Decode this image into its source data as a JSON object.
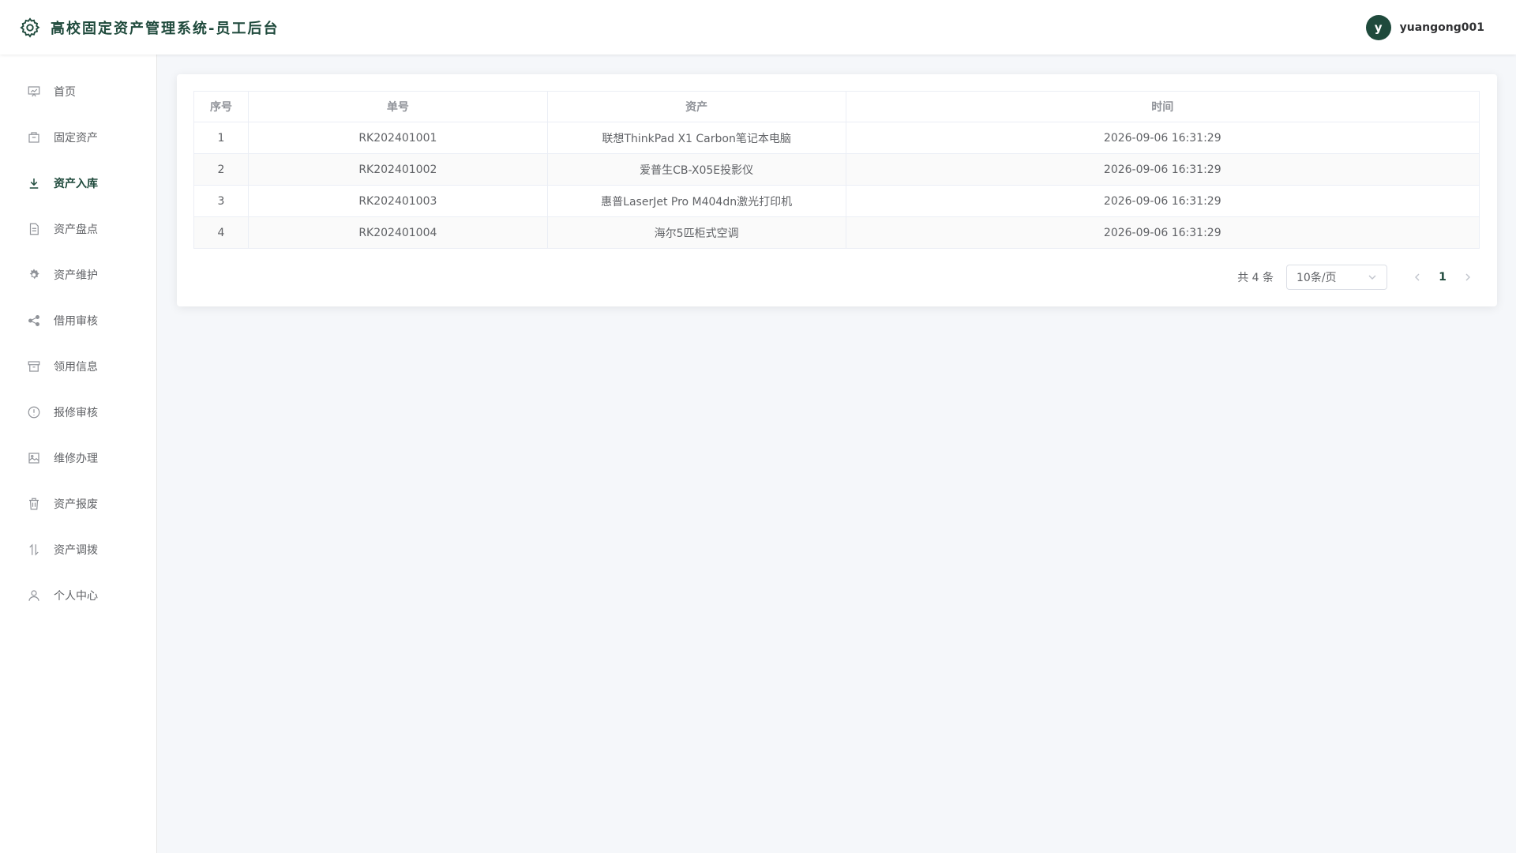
{
  "header": {
    "title": "高校固定资产管理系统-员工后台",
    "avatar_letter": "y",
    "username": "yuangong001",
    "brand_color": "#1f4a3c"
  },
  "sidebar": {
    "items": [
      {
        "label": "首页",
        "icon": "chart-board-icon"
      },
      {
        "label": "固定资产",
        "icon": "box-icon"
      },
      {
        "label": "资产入库",
        "icon": "download-icon",
        "active": true
      },
      {
        "label": "资产盘点",
        "icon": "document-icon"
      },
      {
        "label": "资产维护",
        "icon": "gear-icon"
      },
      {
        "label": "借用审核",
        "icon": "share-icon"
      },
      {
        "label": "领用信息",
        "icon": "archive-icon"
      },
      {
        "label": "报修审核",
        "icon": "info-circle-icon"
      },
      {
        "label": "维修办理",
        "icon": "picture-icon"
      },
      {
        "label": "资产报废",
        "icon": "trash-icon"
      },
      {
        "label": "资产调拨",
        "icon": "transfer-icon"
      },
      {
        "label": "个人中心",
        "icon": "user-icon"
      }
    ]
  },
  "table": {
    "columns": [
      "序号",
      "单号",
      "资产",
      "时间"
    ],
    "rows": [
      [
        "1",
        "RK202401001",
        "联想ThinkPad X1 Carbon笔记本电脑",
        "2026-09-06 16:31:29"
      ],
      [
        "2",
        "RK202401002",
        "爱普生CB-X05E投影仪",
        "2026-09-06 16:31:29"
      ],
      [
        "3",
        "RK202401003",
        "惠普LaserJet Pro M404dn激光打印机",
        "2026-09-06 16:31:29"
      ],
      [
        "4",
        "RK202401004",
        "海尔5匹柜式空调",
        "2026-09-06 16:31:29"
      ]
    ]
  },
  "pagination": {
    "total_text": "共 4 条",
    "page_size": "10条/页",
    "current_page": "1"
  }
}
